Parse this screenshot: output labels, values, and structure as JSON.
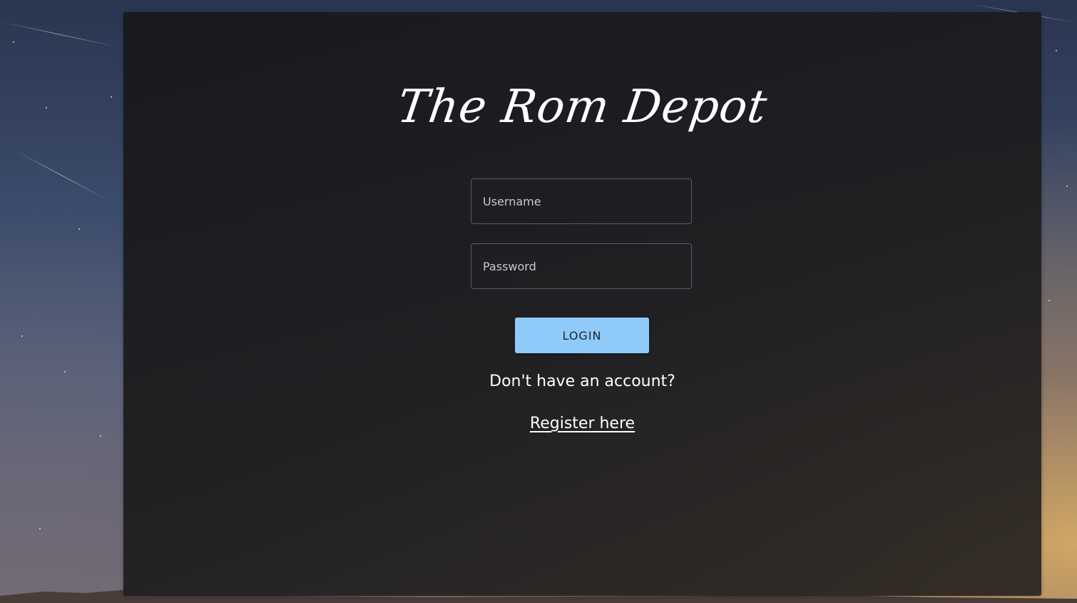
{
  "brand": {
    "logo_text": "The Rom Depot"
  },
  "login_form": {
    "username_placeholder": "Username",
    "username_value": "",
    "password_placeholder": "Password",
    "password_value": "",
    "login_label": "LOGIN"
  },
  "signup": {
    "prompt": "Don't have an account?",
    "link_label": "Register here"
  },
  "colors": {
    "login_button": "#90caf9",
    "panel": "#1e1e20",
    "text": "#ffffff"
  }
}
